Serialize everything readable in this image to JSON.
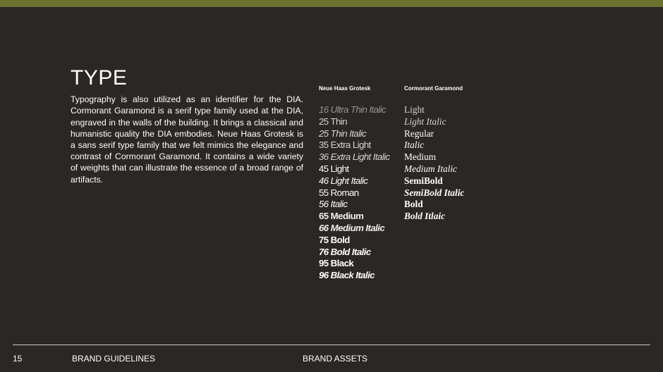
{
  "title": "TYPE",
  "body": "Typography is also utilized as an identifier for the DIA. Cormorant Garamond is a serif type family used at the DIA, engraved in the walls of the building. It brings a classical and humanistic quality the DIA embodies. Neue Haas Grotesk is a sans serif type family that we felt mimics the elegance and contrast of Cormorant Garamond. It contains a wide variety of weights that can illustrate the essence of a broad range of artifacts.",
  "fonts": {
    "sans": {
      "name": "Neue Haas Grotesk",
      "weights": [
        "16 Ultra Thin Italic",
        "25 Thin",
        "25 Thin Italic",
        "35 Extra Light",
        "36 Extra Light Italic",
        "45 Light",
        "46 Light Italic",
        "55 Roman",
        "56 Italic",
        "65 Medium",
        "66 Medium Italic",
        "75 Bold",
        "76 Bold Italic",
        "95 Black",
        "96 Black Italic"
      ]
    },
    "serif": {
      "name": "Cormorant Garamond",
      "weights": [
        "Light",
        "Light Italic",
        "Regular",
        "Italic",
        "Medium",
        "Medium Italic",
        "SemiBold",
        "SemiBold Italic",
        "Bold",
        "Bold Itlaic"
      ]
    }
  },
  "footer": {
    "page": "15",
    "left": "BRAND GUIDELINES",
    "middle": "BRAND ASSETS"
  },
  "colors": {
    "background": "#2b2725",
    "accent_bar": "#6b7230",
    "text": "#ffffff"
  }
}
